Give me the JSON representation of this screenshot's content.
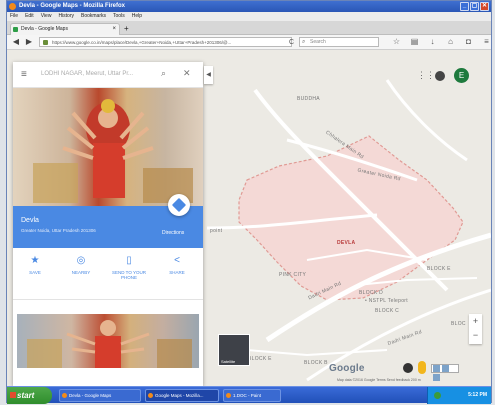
{
  "window": {
    "title": "Devla - Google Maps - Mozilla Firefox",
    "controls": [
      "_",
      "▢",
      "✕"
    ]
  },
  "menu": [
    "File",
    "Edit",
    "View",
    "History",
    "Bookmarks",
    "Tools",
    "Help"
  ],
  "tabs": [
    {
      "label": "Devla - Google Maps",
      "close": "×"
    }
  ],
  "new_tab": "+",
  "nav": {
    "url": "https://www.google.co.in/maps/place/Devla,+Greater+Noida,+Uttar+Pradesh+201306/@...",
    "search_placeholder": "Search",
    "back": "◀",
    "forward": "▶",
    "reload": "C"
  },
  "toolbar_icons": [
    "star-icon",
    "clipboard-icon",
    "download-icon",
    "home-icon",
    "pocket-icon",
    "menu-icon"
  ],
  "map": {
    "labels": {
      "buddha": "BUDDHA",
      "devla": "DEVLA",
      "pink_city": "PINK CITY",
      "block_d": "BLOCK D",
      "block_c": "BLOCK C",
      "block_e": "BLOCK E",
      "block_e2": "BLOCK E",
      "block_b": "BLOCK B",
      "ntpl": "• NSTPL Teleport",
      "road1": "Chhalera Main Rd",
      "road2": "Greater Noida Rd",
      "road3": "Dadri Main Rd",
      "road4": "Dadri Main Rd",
      "bloc": "BLOC",
      "left_edge": "point"
    },
    "satellite_label": "Satellite",
    "google_logo": "Google",
    "footnote": "Map data ©2016 Google   Terms   Send feedback   200 m",
    "avatar_letter": "E",
    "zoom_in": "+",
    "zoom_out": "−"
  },
  "panel": {
    "search_value": "LODHI NAGAR, Meerut, Uttar Pr...",
    "place_name": "Devla",
    "place_address": "Greater Noida, Uttar Pradesh 201306",
    "directions_label": "Directions",
    "collapse": "◀",
    "actions": [
      {
        "label": "SAVE",
        "icon": "★"
      },
      {
        "label": "NEARBY",
        "icon": "◎"
      },
      {
        "label": "SEND TO YOUR PHONE",
        "icon": "▯"
      },
      {
        "label": "SHARE",
        "icon": "<"
      }
    ]
  },
  "taskbar": {
    "start": "start",
    "tasks": [
      "Devla - Google Maps",
      "Google Maps - Mozilla...",
      "1.DOC - Paint"
    ],
    "time": "5:12 PM"
  },
  "colors": {
    "highlight_area": "#f4d9d6",
    "highlight_border": "#e09a94",
    "panel_blue": "#4a89e3"
  }
}
